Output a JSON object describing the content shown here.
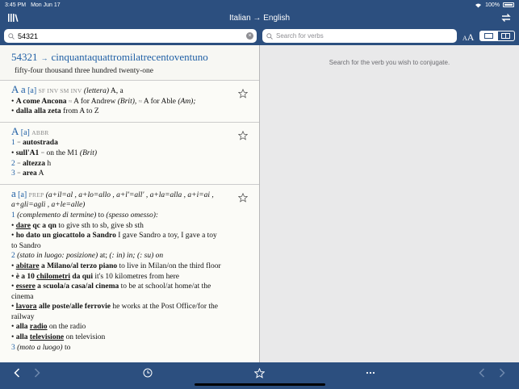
{
  "status": {
    "time": "3:45 PM",
    "date": "Mon Jun 17",
    "battery": "100%"
  },
  "nav": {
    "title": "Italian → English"
  },
  "search": {
    "value": "54321",
    "verb_placeholder": "Search for verbs"
  },
  "right_panel": {
    "hint": "Search for the verb you wish to conjugate."
  },
  "number_entry": {
    "numeral": "54321",
    "arrow": "→",
    "words": "cinquantaquattromilatrecentoventuno",
    "translation": "fifty-four thousand three hundred twenty-one"
  },
  "entry1": {
    "headword": "A a",
    "pron": "[a]",
    "gram": "SF INV SM INV",
    "gloss": "(lettera)",
    "gloss_tr": "A, a",
    "ex1_it": "A come Ancona",
    "eq": "≈",
    "ex1_en1": "A for Andrew",
    "ex1_brit": "(Brit),",
    "ex1_en2": "A for Able",
    "ex1_am": "(Am);",
    "ex2_it": "dalla alla zeta",
    "ex2_en": "from A to Z"
  },
  "entry2": {
    "headword": "A",
    "pron": "[a]",
    "gram": "ABBR",
    "s1": "1",
    "s1_text": "autostrada",
    "ex_it": "sull'A1",
    "ex_en": "on the M1",
    "ex_brit": "(Brit)",
    "s2": "2",
    "s2_text": "altezza",
    "s2_tr": "h",
    "s3": "3",
    "s3_text": "area",
    "s3_tr": "A"
  },
  "entry3": {
    "headword": "a",
    "pron": "[a]",
    "gram": "PREP",
    "forms_line1": "(a+il=al , a+lo=allo , a+l'=all' , a+la=alla , a+i=ai ,",
    "forms_line2": "a+gli=agli , a+le=alle)",
    "s1": "1",
    "s1_gloss": "(complemento di termine)",
    "s1_tr": "to",
    "s1_note": "(spesso omesso):",
    "l1_u": "dare",
    "l1_b": "qc a qn",
    "l1_t": "to give sth to sb, give sb sth",
    "l2_b": "ho dato un giocattolo a Sandro",
    "l2_t": "I gave Sandro a toy, I gave a toy",
    "l2_t2": "to Sandro",
    "s2": "2",
    "s2_gloss": "(stato in luogo: posizione)",
    "s2_tr": "at;",
    "s2_rest": "(: in) in;  (: su) on",
    "l3_u": "abitare",
    "l3_b": "a Milano/al terzo piano",
    "l3_t": "to live in Milan/on the third floor",
    "l4_b1": "è a 10",
    "l4_u": "chilometri",
    "l4_b2": "da qui",
    "l4_t": "it's 10 kilometres from here",
    "l5_u": "essere",
    "l5_b": "a scuola/a casa/al cinema",
    "l5_t": "to be at school/at home/at the",
    "l5_t2": "cinema",
    "l6_u": "lavora",
    "l6_b": "alle poste/alle ferrovie",
    "l6_t": "he works at the Post Office/for the",
    "l6_t2": "railway",
    "l7_b": "alla",
    "l7_u": "radio",
    "l7_t": "on the radio",
    "l8_b": "alla",
    "l8_u": "televisione",
    "l8_t": "on television",
    "s3": "3",
    "s3_gloss": "(moto a luogo)",
    "s3_tr": "to"
  },
  "colors": {
    "bar": "#2c4f7f",
    "headword": "#1f5fa5",
    "panel": "#e9e9ea",
    "entry_bg": "#fbfbf7"
  },
  "icons": [
    "library-icon",
    "swap-icon",
    "search-icon",
    "clear-icon",
    "text-size-icon",
    "single-pane-icon",
    "split-pane-icon",
    "star-icon",
    "back-icon",
    "forward-icon",
    "history-icon",
    "favorites-icon",
    "more-icon",
    "prev-icon",
    "next-icon"
  ],
  "toolbar": {
    "text_size_small": "A",
    "text_size_big": "A"
  }
}
